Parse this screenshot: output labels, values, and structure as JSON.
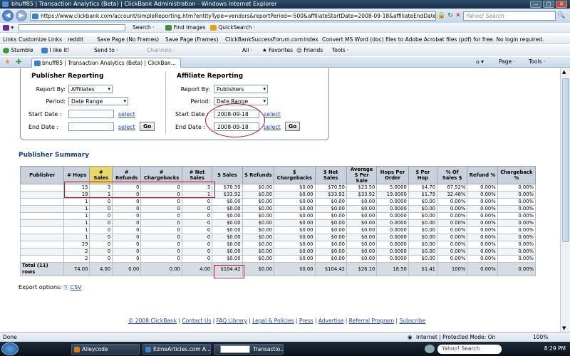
{
  "window": {
    "title": "bhuff85 | Transaction Analytics (Beta) | ClickBank Administration - Windows Internet Explorer",
    "min": "—",
    "max": "□",
    "close": "✕"
  },
  "address": {
    "url": "https://www.clickbank.com/account/simpleReporting.htm?entityType=vendors&reportPeriod=-500&affiliateStartDate=2008-09-18&affiliateEndDate=2008-0",
    "search_placeholder": "Yahoo! Search"
  },
  "menubar": {
    "search": "Search ·",
    "find_images": "Find Images",
    "quicksearch": "QuickSearch ·"
  },
  "links_bar": {
    "label": "Links",
    "items": [
      "Customize Links",
      "reddit",
      "Save Page (No Frames)",
      "Save Page (Frames)",
      "ClickBankSuccessForum.com",
      "Index",
      "Convert MS Word (doc) files to Adobe Acrobat files (pdf) for free. No login required."
    ]
  },
  "stumble_bar": {
    "stumble": "Stumble",
    "like": "I like it!",
    "send": "Send to ·",
    "channels": "Channels:",
    "all": "All ·",
    "favorites": "Favorites",
    "friends": "Friends",
    "tools": "Tools ·"
  },
  "tab": {
    "title": "bhuff85 | Transaction Analytics (Beta) | ClickBan...",
    "page": "Page ·",
    "tools": "Tools ·"
  },
  "publisher_reporting": {
    "title": "Publisher Reporting",
    "report_by_label": "Report By:",
    "report_by_value": "Affiliates",
    "period_label": "Period:",
    "period_value": "Date Range",
    "start_label": "Start Date :",
    "start_value": "",
    "start_link": "select",
    "end_label": "End Date :",
    "end_value": "",
    "end_link": "select",
    "go": "Go"
  },
  "affiliate_reporting": {
    "title": "Affiliate Reporting",
    "report_by_label": "Report By:",
    "report_by_value": "Publishers",
    "period_label": "Period:",
    "period_value": "Date Range",
    "start_label": "Start Date :",
    "start_value": "2008-09-18",
    "start_link": "select",
    "end_label": "End Date :",
    "end_value": "2008-09-18",
    "end_link": "select",
    "go": "Go"
  },
  "summary": {
    "title": "Publisher Summary",
    "headers": [
      "Publisher",
      "# Hops",
      "# Sales",
      "# Refunds",
      "# Chargebacks",
      "# Net Sales",
      "$ Sales",
      "$ Refunds",
      "$ Chargebacks",
      "$ Net Sales",
      "Average $ Per Sale",
      "Hops Per Order",
      "$ Per Hop",
      "% Of Sales $",
      "Refund %",
      "Chargeback %"
    ],
    "rows": [
      [
        "",
        "15",
        "3",
        "0",
        "0",
        "3",
        "$70.50",
        "$0.00",
        "$0.00",
        "$70.50",
        "$23.50",
        "5.0000",
        "$4.70",
        "67.52%",
        "0.00%",
        "0.00%"
      ],
      [
        "",
        "19",
        "1",
        "0",
        "0",
        "1",
        "$33.92",
        "$0.00",
        "$0.00",
        "$33.92",
        "$33.92",
        "19.0000",
        "$1.79",
        "32.48%",
        "0.00%",
        "0.00%"
      ],
      [
        "",
        "1",
        "0",
        "0",
        "0",
        "0",
        "$0.00",
        "$0.00",
        "$0.00",
        "$0.00",
        "$0.00",
        "0.0000",
        "$0.00",
        "0.00%",
        "0.00%",
        "0.00%"
      ],
      [
        "",
        "1",
        "0",
        "0",
        "0",
        "0",
        "$0.00",
        "$0.00",
        "$0.00",
        "$0.00",
        "$0.00",
        "0.0000",
        "$0.00",
        "0.00%",
        "0.00%",
        "0.00%"
      ],
      [
        "",
        "1",
        "0",
        "0",
        "0",
        "0",
        "$0.00",
        "$0.00",
        "$0.00",
        "$0.00",
        "$0.00",
        "0.0000",
        "$0.00",
        "0.00%",
        "0.00%",
        "0.00%"
      ],
      [
        "",
        "1",
        "0",
        "0",
        "0",
        "0",
        "$0.00",
        "$0.00",
        "$0.00",
        "$0.00",
        "$0.00",
        "0.0000",
        "$0.00",
        "0.00%",
        "0.00%",
        "0.00%"
      ],
      [
        "",
        "1",
        "0",
        "0",
        "0",
        "0",
        "$0.00",
        "$0.00",
        "$0.00",
        "$0.00",
        "$0.00",
        "0.0000",
        "$0.00",
        "0.00%",
        "0.00%",
        "0.00%"
      ],
      [
        "",
        "1",
        "0",
        "0",
        "0",
        "0",
        "$0.00",
        "$0.00",
        "$0.00",
        "$0.00",
        "$0.00",
        "0.0000",
        "$0.00",
        "0.00%",
        "0.00%",
        "0.00%"
      ],
      [
        "",
        "29",
        "0",
        "0",
        "0",
        "0",
        "$0.00",
        "$0.00",
        "$0.00",
        "$0.00",
        "$0.00",
        "0.0000",
        "$0.00",
        "0.00%",
        "0.00%",
        "0.00%"
      ],
      [
        "",
        "2",
        "0",
        "0",
        "0",
        "0",
        "$0.00",
        "$0.00",
        "$0.00",
        "$0.00",
        "$0.00",
        "0.0000",
        "$0.00",
        "0.00%",
        "0.00%",
        "0.00%"
      ],
      [
        "",
        "2",
        "0",
        "0",
        "0",
        "0",
        "$0.00",
        "$0.00",
        "$0.00",
        "$0.00",
        "$0.00",
        "0.0000",
        "$0.00",
        "0.00%",
        "0.00%",
        "0.00%"
      ]
    ],
    "total": [
      "Total (11) rows",
      "74.00",
      "4.00",
      "0.00",
      "0.00",
      "4.00",
      "$104.42",
      "$0.00",
      "$0.00",
      "$104.42",
      "$26.10",
      "18.50",
      "$1.41",
      "100%",
      "0.00%",
      "0.00%"
    ]
  },
  "export": {
    "label": "Export options:",
    "csv": "CSV"
  },
  "footer": {
    "items": [
      "© 2008 ClickBank",
      "Contact Us",
      "FAQ Library",
      "Legal & Policies",
      "Press",
      "Advertise",
      "Referral Program",
      "Subscribe"
    ]
  },
  "status": {
    "left": "Done",
    "zone": "Internet | Protected Mode: On",
    "zoom": "100%"
  },
  "taskbar": {
    "items": [
      "Alleycode",
      "EzineArticles.com A...",
      "",
      "Transactio..."
    ],
    "search": "Yahoo! Search",
    "clock": "8:29 PM"
  },
  "colors": {
    "accent": "#173c74",
    "highlight_red": "#c0141d",
    "sorted_header": "#e8d86a"
  }
}
